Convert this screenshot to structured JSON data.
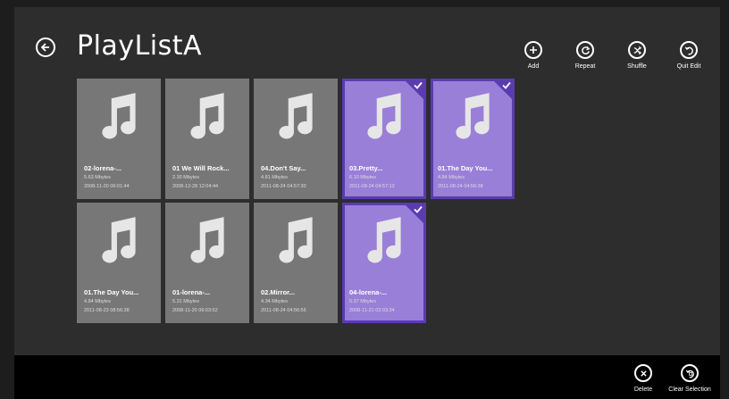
{
  "header": {
    "title": "PlayListA"
  },
  "toolbar": {
    "buttons": [
      {
        "label": "Add",
        "icon": "add-icon"
      },
      {
        "label": "Repeat",
        "icon": "repeat-icon"
      },
      {
        "label": "Shuffle",
        "icon": "shuffle-icon"
      },
      {
        "label": "Quit Edit",
        "icon": "quit-edit-icon"
      }
    ]
  },
  "tiles": [
    {
      "title": "02-lorena-...",
      "size": "5.63 Mbytes",
      "date": "2008-11-20 06:01:44",
      "selected": false
    },
    {
      "title": "01 We Will Rock...",
      "size": "2.30 Mbytes",
      "date": "2008-12-28 12:04:44",
      "selected": false
    },
    {
      "title": "04.Don't Say...",
      "size": "4.81 Mbytes",
      "date": "2011-08-24 04:57:30",
      "selected": false
    },
    {
      "title": "03.Pretty...",
      "size": "6.10 Mbytes",
      "date": "2011-08-24 04:57:12",
      "selected": true
    },
    {
      "title": "01.The Day You...",
      "size": "4.84 Mbytes",
      "date": "2011-08-24 04:56:38",
      "selected": true
    },
    {
      "title": "01.The Day You...",
      "size": "4.84 Mbytes",
      "date": "2011-08-23 08:56:38",
      "selected": false
    },
    {
      "title": "01-lorena-...",
      "size": "5.31 Mbytes",
      "date": "2008-11-20 06:03:52",
      "selected": false
    },
    {
      "title": "02.Mirror...",
      "size": "4.34 Mbytes",
      "date": "2011-08-24 04:56:56",
      "selected": false
    },
    {
      "title": "04-lorena-...",
      "size": "5.37 Mbytes",
      "date": "2008-11-21 02:03:34",
      "selected": true
    }
  ],
  "appbar": {
    "buttons": [
      {
        "label": "Delete",
        "icon": "delete-icon"
      },
      {
        "label": "Clear Selection",
        "icon": "clear-selection-icon"
      }
    ]
  },
  "colors": {
    "selected_fill": "#9a7fd8",
    "selected_border": "#5a3cb0",
    "tile_fill": "#777777"
  }
}
